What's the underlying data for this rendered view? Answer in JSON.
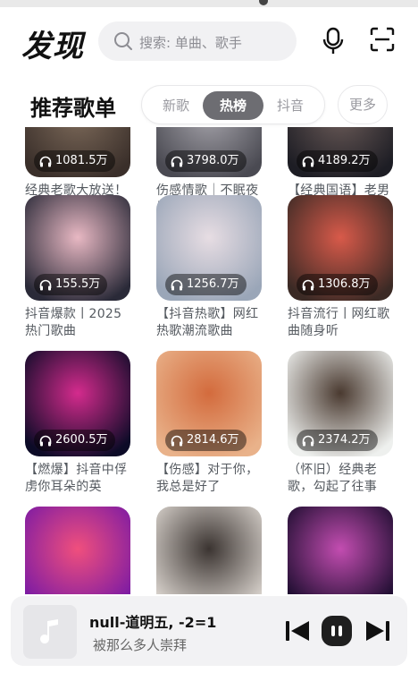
{
  "header": {
    "logo": "发现",
    "search_placeholder": "搜索: 单曲、歌手"
  },
  "section": {
    "title": "推荐歌单",
    "tabs": [
      {
        "label": "新歌",
        "active": false
      },
      {
        "label": "热榜",
        "active": true
      },
      {
        "label": "抖音",
        "active": false
      }
    ],
    "more": "更多"
  },
  "playlists": [
    {
      "title": "经典老歌大放送！一人一首代",
      "count": "1081.5万",
      "palette": [
        "#3a2f2a",
        "#7d6a5a"
      ]
    },
    {
      "title": "伤感情歌｜不眠夜里的孤单心事",
      "count": "3798.0万",
      "palette": [
        "#4a4a52",
        "#a5a3aa"
      ]
    },
    {
      "title": "【经典国语】老男人的情怀老男",
      "count": "4189.2万",
      "palette": [
        "#1d1d24",
        "#6b5b58"
      ]
    },
    {
      "title": "抖音爆款丨2025热门歌曲",
      "count": "155.5万",
      "palette": [
        "#2a2a38",
        "#e8b8c3"
      ]
    },
    {
      "title": "【抖音热歌】网红热歌潮流歌曲",
      "count": "1256.7万",
      "palette": [
        "#9aa6b8",
        "#e7dde3"
      ]
    },
    {
      "title": "抖音流行丨网红歌曲随身听",
      "count": "1306.8万",
      "palette": [
        "#3b2a25",
        "#d85a4a"
      ]
    },
    {
      "title": "【燃爆】抖音中俘虏你耳朵的英",
      "count": "2600.5万",
      "palette": [
        "#0c0b27",
        "#d42b8d"
      ]
    },
    {
      "title": "【伤感】对于你，我总是好了",
      "count": "2814.6万",
      "palette": [
        "#e9b28a",
        "#d36b3d"
      ]
    },
    {
      "title": "（怀旧）经典老歌，勾起了往事",
      "count": "2374.2万",
      "palette": [
        "#eef0ee",
        "#4a3a30"
      ]
    },
    {
      "title": "",
      "count": "",
      "palette": [
        "#7a1aa4",
        "#f04f7d"
      ]
    },
    {
      "title": "",
      "count": "",
      "palette": [
        "#d8d2cc",
        "#3b3431"
      ]
    },
    {
      "title": "",
      "count": "",
      "palette": [
        "#1a0c2d",
        "#c34db1"
      ]
    }
  ],
  "player": {
    "song": "null-道明五, -2=1",
    "artist": "被那么多人崇拜"
  },
  "icons": {
    "search": "search-icon",
    "mic": "mic-icon",
    "scan": "scan-icon",
    "headphones": "headphones-icon",
    "music_note": "music-note-icon",
    "prev": "skip-previous-icon",
    "pause": "pause-icon",
    "next": "skip-next-icon"
  }
}
